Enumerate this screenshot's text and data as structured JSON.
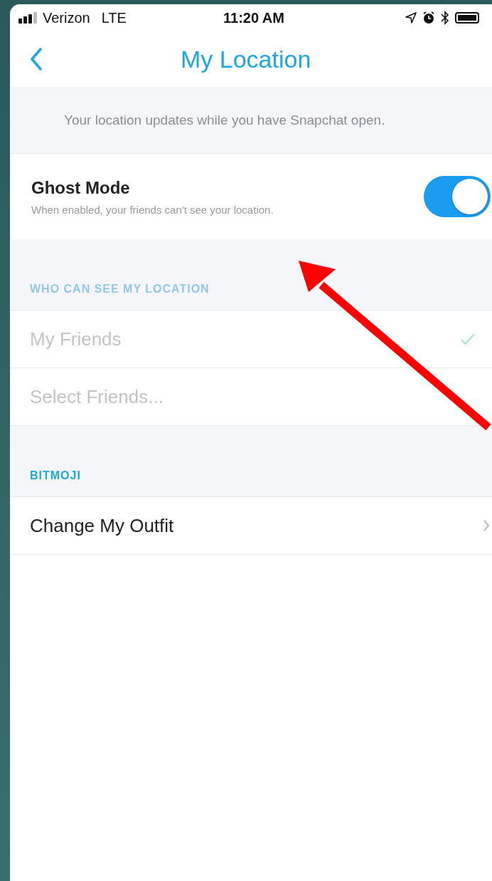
{
  "status_bar": {
    "carrier": "Verizon",
    "network": "LTE",
    "time": "11:20 AM"
  },
  "nav": {
    "title": "My Location"
  },
  "info": "Your location updates while you have Snapchat open.",
  "ghost_mode": {
    "title": "Ghost Mode",
    "description": "When enabled, your friends can't see your location.",
    "on": true
  },
  "sections": [
    {
      "header": "WHO CAN SEE MY LOCATION",
      "disabled": true,
      "kind": "choice",
      "items": [
        {
          "label": "My Friends",
          "selected": true
        },
        {
          "label": "Select Friends...",
          "selected": false
        }
      ]
    },
    {
      "header": "BITMOJI",
      "disabled": false,
      "kind": "link",
      "items": [
        {
          "label": "Change My Outfit"
        }
      ]
    }
  ]
}
